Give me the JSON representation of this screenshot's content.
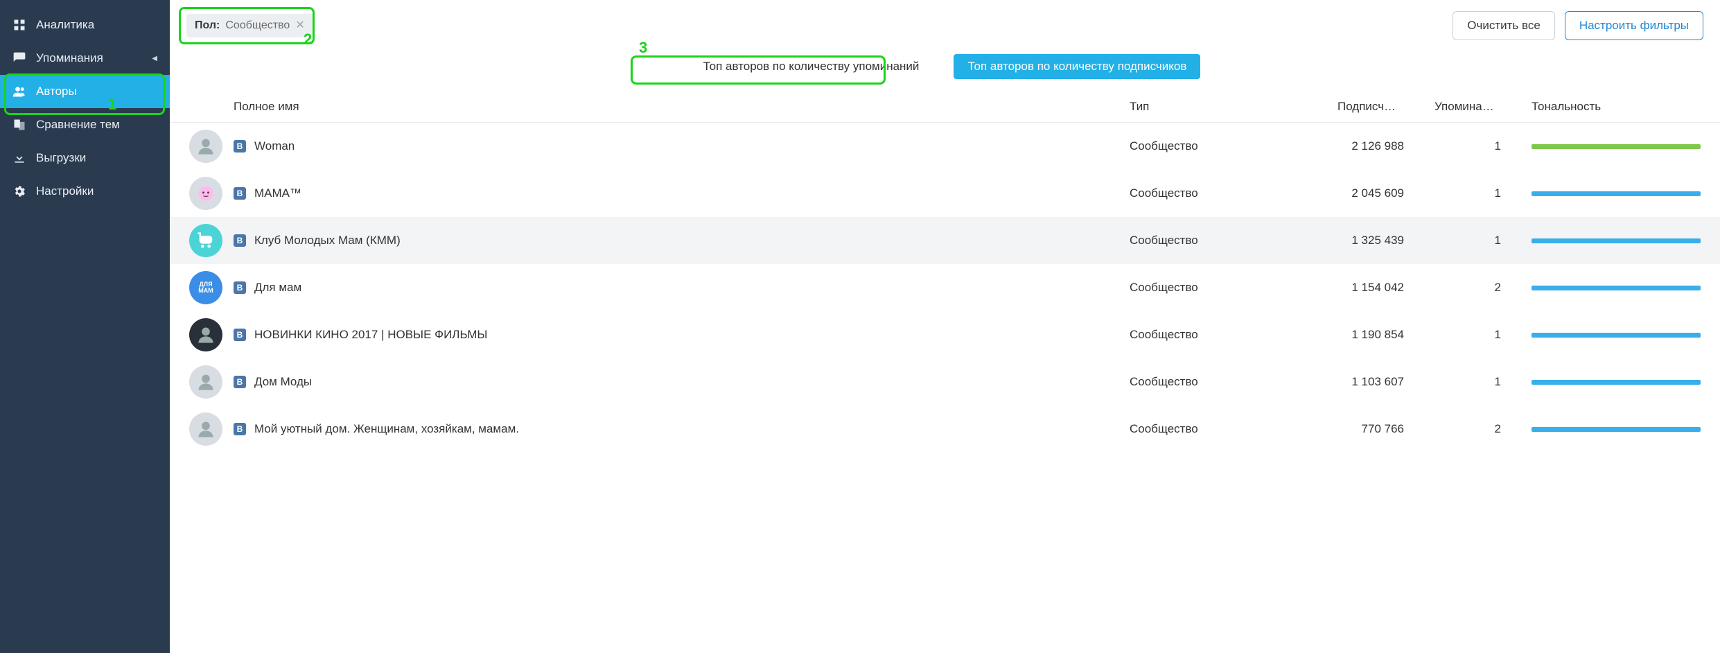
{
  "sidebar": {
    "items": [
      {
        "label": "Аналитика",
        "icon": "dashboard"
      },
      {
        "label": "Упоминания",
        "icon": "mentions",
        "expandable": true
      },
      {
        "label": "Авторы",
        "icon": "authors",
        "active": true
      },
      {
        "label": "Сравнение тем",
        "icon": "compare"
      },
      {
        "label": "Выгрузки",
        "icon": "download"
      },
      {
        "label": "Настройки",
        "icon": "settings"
      }
    ]
  },
  "filter": {
    "label": "Пол:",
    "value": "Сообщество"
  },
  "buttons": {
    "clear": "Очистить все",
    "configure": "Настроить фильтры"
  },
  "tabs": {
    "byMentions": "Топ авторов по количеству упоминаний",
    "bySubscribers": "Топ авторов по количеству подписчиков"
  },
  "table": {
    "headers": {
      "name": "Полное имя",
      "type": "Тип",
      "subscribers": "Подписч…",
      "mentions": "Упомина…",
      "tone": "Тональность"
    },
    "rows": [
      {
        "name": "Woman",
        "type": "Сообщество",
        "subscribers": "2 126 988",
        "mentions": "1",
        "tone": "green",
        "avatar": "person1"
      },
      {
        "name": "МАМА™",
        "type": "Сообщество",
        "subscribers": "2 045 609",
        "mentions": "1",
        "tone": "blue",
        "avatar": "baby"
      },
      {
        "name": "Клуб Молодых Мам (КММ)",
        "type": "Сообщество",
        "subscribers": "1 325 439",
        "mentions": "1",
        "tone": "blue",
        "avatar": "stroller",
        "hover": true
      },
      {
        "name": "Для мам",
        "type": "Сообщество",
        "subscribers": "1 154 042",
        "mentions": "2",
        "tone": "blue",
        "avatar": "cloud"
      },
      {
        "name": "НОВИНКИ КИНО 2017 | НОВЫЕ ФИЛЬМЫ",
        "type": "Сообщество",
        "subscribers": "1 190 854",
        "mentions": "1",
        "tone": "blue",
        "avatar": "movie"
      },
      {
        "name": "Дом Моды",
        "type": "Сообщество",
        "subscribers": "1 103 607",
        "mentions": "1",
        "tone": "blue",
        "avatar": "fashion"
      },
      {
        "name": "Мой уютный дом. Женщинам, хозяйкам, мамам.",
        "type": "Сообщество",
        "subscribers": "770 766",
        "mentions": "2",
        "tone": "blue",
        "avatar": "home"
      }
    ]
  },
  "annotations": {
    "n1": "1",
    "n2": "2",
    "n3": "3"
  }
}
